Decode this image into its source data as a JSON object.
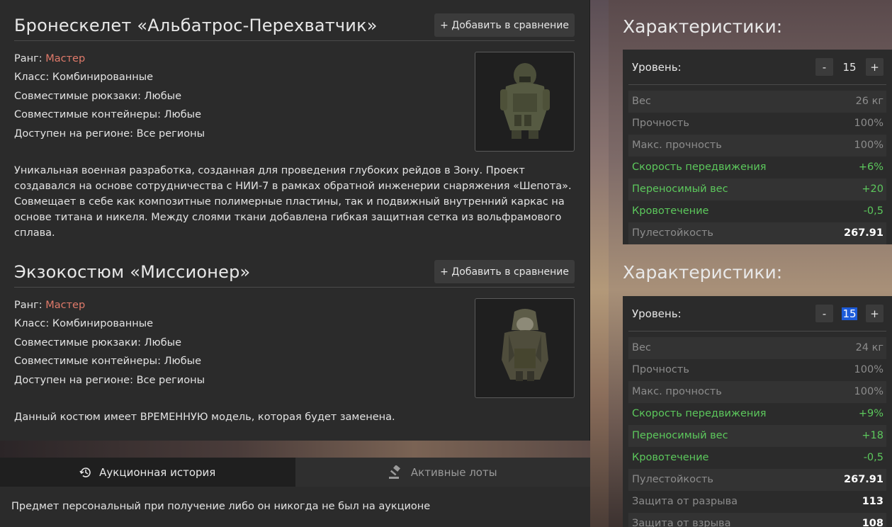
{
  "items": [
    {
      "title": "Бронескелет «Альбатрос-Перехватчик»",
      "compare_label": "+ Добавить в сравнение",
      "rank_label": "Ранг:",
      "rank_value": "Мастер",
      "class_line": "Класс: Комбинированные",
      "backpacks_line": "Совместимые рюкзаки: Любые",
      "containers_line": "Совместимые контейнеры: Любые",
      "region_line": "Доступен на регионе: Все регионы",
      "description": "Уникальная военная разработка, созданная для проведения глубоких рейдов в Зону. Проект создавался на основе сотрудничества с НИИ-7 в рамках обратной инженерии снаряжения «Шепота». Совмещает в себе как композитные полимерные пластины, так и подвижный внутренний каркас на основе титана и никеля. Между слоями ткани добавлена гибкая защитная сетка из вольфрамового сплава."
    },
    {
      "title": "Экзокостюм «Миссионер»",
      "compare_label": "+ Добавить в сравнение",
      "rank_label": "Ранг:",
      "rank_value": "Мастер",
      "class_line": "Класс: Комбинированные",
      "backpacks_line": "Совместимые рюкзаки: Любые",
      "containers_line": "Совместимые контейнеры: Любые",
      "region_line": "Доступен на регионе: Все регионы",
      "description": "Данный костюм имеет ВРЕМЕННУЮ модель, которая будет заменена."
    }
  ],
  "tabs": {
    "history_label": "Аукционная история",
    "active_label": "Активные лоты",
    "content": "Предмет персональный при получение либо он никогда не был на аукционе"
  },
  "stats": [
    {
      "title": "Характеристики:",
      "level_label": "Уровень:",
      "minus": "-",
      "plus": "+",
      "level": "15",
      "rows": [
        {
          "name": "Вес",
          "value": "26 кг"
        },
        {
          "name": "Прочность",
          "value": "100%"
        },
        {
          "name": "Макс. прочность",
          "value": "100%"
        },
        {
          "name": "Скорость передвижения",
          "value": "+6%"
        },
        {
          "name": "Переносимый вес",
          "value": "+20"
        },
        {
          "name": "Кровотечение",
          "value": "-0,5"
        },
        {
          "name": "Пулестойкость",
          "value": "267.91"
        }
      ]
    },
    {
      "title": "Характеристики:",
      "level_label": "Уровень:",
      "minus": "-",
      "plus": "+",
      "level": "15",
      "rows": [
        {
          "name": "Вес",
          "value": "24 кг"
        },
        {
          "name": "Прочность",
          "value": "100%"
        },
        {
          "name": "Макс. прочность",
          "value": "100%"
        },
        {
          "name": "Скорость передвижения",
          "value": "+9%"
        },
        {
          "name": "Переносимый вес",
          "value": "+18"
        },
        {
          "name": "Кровотечение",
          "value": "-0,5"
        },
        {
          "name": "Пулестойкость",
          "value": "267.91"
        },
        {
          "name": "Защита от разрыва",
          "value": "113"
        },
        {
          "name": "Защита от взрыва",
          "value": "108"
        }
      ]
    }
  ],
  "colors": {
    "rank": "#e07a6a",
    "positive": "#5cc85c",
    "selection": "#1d5bd8"
  }
}
